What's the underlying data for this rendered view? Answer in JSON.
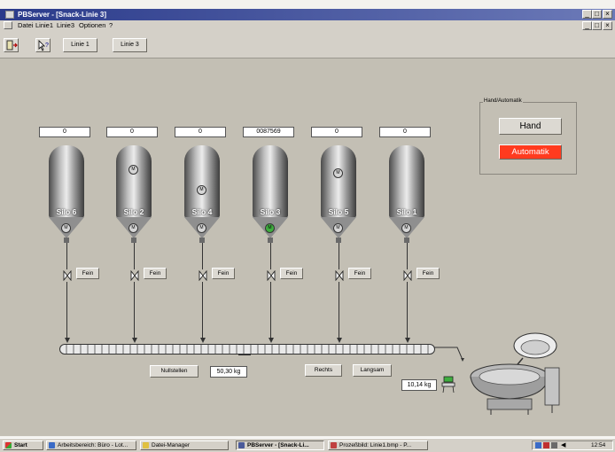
{
  "window": {
    "title": "PBServer - [Snack-Linie 3]"
  },
  "menu": [
    "Datei",
    "Linie1",
    "Linie3",
    "Optionen",
    "?"
  ],
  "toolbar": {
    "buttons": [
      "Linie 1",
      "Linie 3"
    ]
  },
  "silos": [
    {
      "label": "Silo 6",
      "counter": "0",
      "motor_top": false,
      "motor_bottom": "M",
      "fein": "Fein"
    },
    {
      "label": "Silo 2",
      "counter": "0",
      "motor_top": "M",
      "motor_bottom": "M",
      "fein": "Fein"
    },
    {
      "label": "Silo 4",
      "counter": "0",
      "motor_top": "M",
      "motor_bottom": "M",
      "fein": "Fein"
    },
    {
      "label": "Silo 3",
      "counter": "0087569",
      "motor_top": false,
      "motor_bottom": "M",
      "fein": "Fein"
    },
    {
      "label": "Silo 5",
      "counter": "0",
      "motor_top": "M",
      "motor_bottom": "M",
      "fein": "Fein"
    },
    {
      "label": "Silo 1",
      "counter": "0",
      "motor_top": false,
      "motor_bottom": "M",
      "fein": "Fein"
    }
  ],
  "mode_group": {
    "caption": "Hand/Automatik",
    "hand": "Hand",
    "automatik": "Automatik",
    "active_color": "#ff3b1f"
  },
  "conveyor": {
    "nullstellen": "Nullstellen",
    "weight": "50,30 kg",
    "rechts": "Rechts",
    "langsam": "Langsam"
  },
  "scale_weight": "10,14 kg",
  "taskbar": {
    "start": "Start",
    "items": [
      "Arbeitsbereich: Büro - Lot...",
      "Datei-Manager",
      "PBServer - [Snack-Li...",
      "Prozeßbild: Linie1.bmp - P..."
    ],
    "clock": "12:54"
  }
}
